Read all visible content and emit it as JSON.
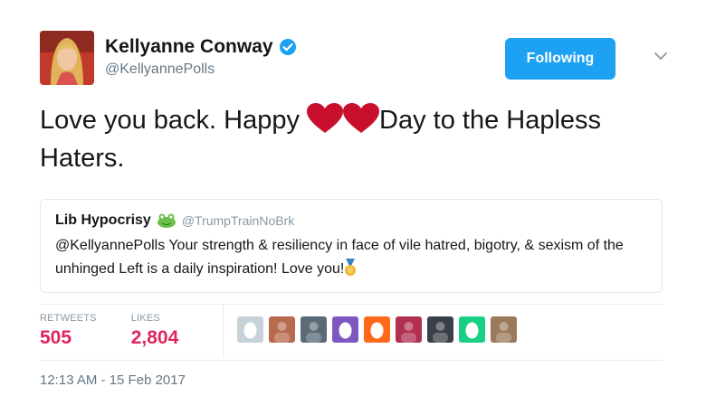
{
  "author": {
    "display_name": "Kellyanne Conway",
    "handle": "@KellyannePolls",
    "verified": true
  },
  "follow_button": {
    "label": "Following"
  },
  "tweet": {
    "text_before": "Love you back. Happy ",
    "text_after": "Day to the Hapless Haters.",
    "emoji": [
      "red-heart",
      "red-heart"
    ]
  },
  "quoted_tweet": {
    "display_name": "Lib Hypocrisy",
    "handle": "@TrumpTrainNoBrk",
    "text": "@KellyannePolls Your strength & resiliency in face of vile hatred, bigotry, & sexism of the unhinged Left is a daily inspiration! Love you!",
    "emoji": "medal"
  },
  "stats": {
    "retweets_label": "RETWEETS",
    "retweets_value": "505",
    "likes_label": "LIKES",
    "likes_value": "2,804"
  },
  "likers": [
    {
      "kind": "egg",
      "color": "#c7d1d8"
    },
    {
      "kind": "photo",
      "color": "#b86a4e"
    },
    {
      "kind": "photo",
      "color": "#5a6a76"
    },
    {
      "kind": "egg",
      "color": "#7e57c2"
    },
    {
      "kind": "egg",
      "color": "#ff6a1a"
    },
    {
      "kind": "photo",
      "color": "#b03050"
    },
    {
      "kind": "photo",
      "color": "#3a4048"
    },
    {
      "kind": "egg",
      "color": "#19cf86"
    },
    {
      "kind": "photo",
      "color": "#9a7a5a"
    }
  ],
  "timestamp": "12:13 AM - 15 Feb 2017",
  "colors": {
    "accent": "#1da1f2",
    "like": "#e0245e",
    "muted": "#657786"
  }
}
